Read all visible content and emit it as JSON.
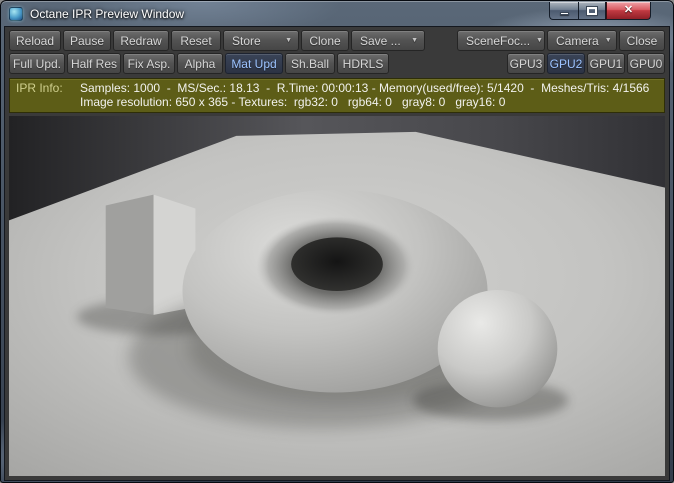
{
  "window": {
    "title": "Octane IPR Preview Window",
    "close_glyph": "✕"
  },
  "icons": {
    "dropdown": "▼"
  },
  "toolbar1": {
    "items": [
      {
        "label": "Reload"
      },
      {
        "label": "Pause"
      },
      {
        "label": "Redraw"
      },
      {
        "label": "Reset"
      },
      {
        "label": "Store",
        "dropdown": true
      },
      {
        "label": "Clone"
      },
      {
        "label": "Save ...",
        "dropdown": true
      },
      {
        "label": "SceneFoc...",
        "dropdown": true
      },
      {
        "label": "Camera",
        "dropdown": true
      },
      {
        "label": "Close"
      }
    ]
  },
  "toolbar2": {
    "items": [
      {
        "label": "Full Upd."
      },
      {
        "label": "Half Res"
      },
      {
        "label": "Fix Asp."
      },
      {
        "label": "Alpha"
      },
      {
        "label": "Mat Upd",
        "active": true
      },
      {
        "label": "Sh.Ball"
      },
      {
        "label": "HDRLS"
      }
    ],
    "gpus": [
      {
        "label": "GPU3"
      },
      {
        "label": "GPU2",
        "active": true
      },
      {
        "label": "GPU1"
      },
      {
        "label": "GPU0"
      }
    ]
  },
  "info": {
    "label": "IPR Info:",
    "line1": "Samples: 1000  -  MS/Sec.: 18.13  -  R.Time: 00:00:13 - Memory(used/free): 5/1420  -  Meshes/Tris: 4/1566",
    "line2": "Image resolution: 650 x 365 - Textures:  rgb32: 0   rgb64: 0   gray8: 0   gray16: 0"
  },
  "viewport": {
    "description": "3D preview render: gray torus, sphere and cube on a gray ground plane"
  },
  "colors": {
    "accent_text": "#9cc3ff",
    "active_button_bg": "#3a4458",
    "button_text": "#d6d6d6",
    "info_bg": "#5d5d17",
    "info_label": "#cfcf8e",
    "close_red": "#c13a42"
  }
}
